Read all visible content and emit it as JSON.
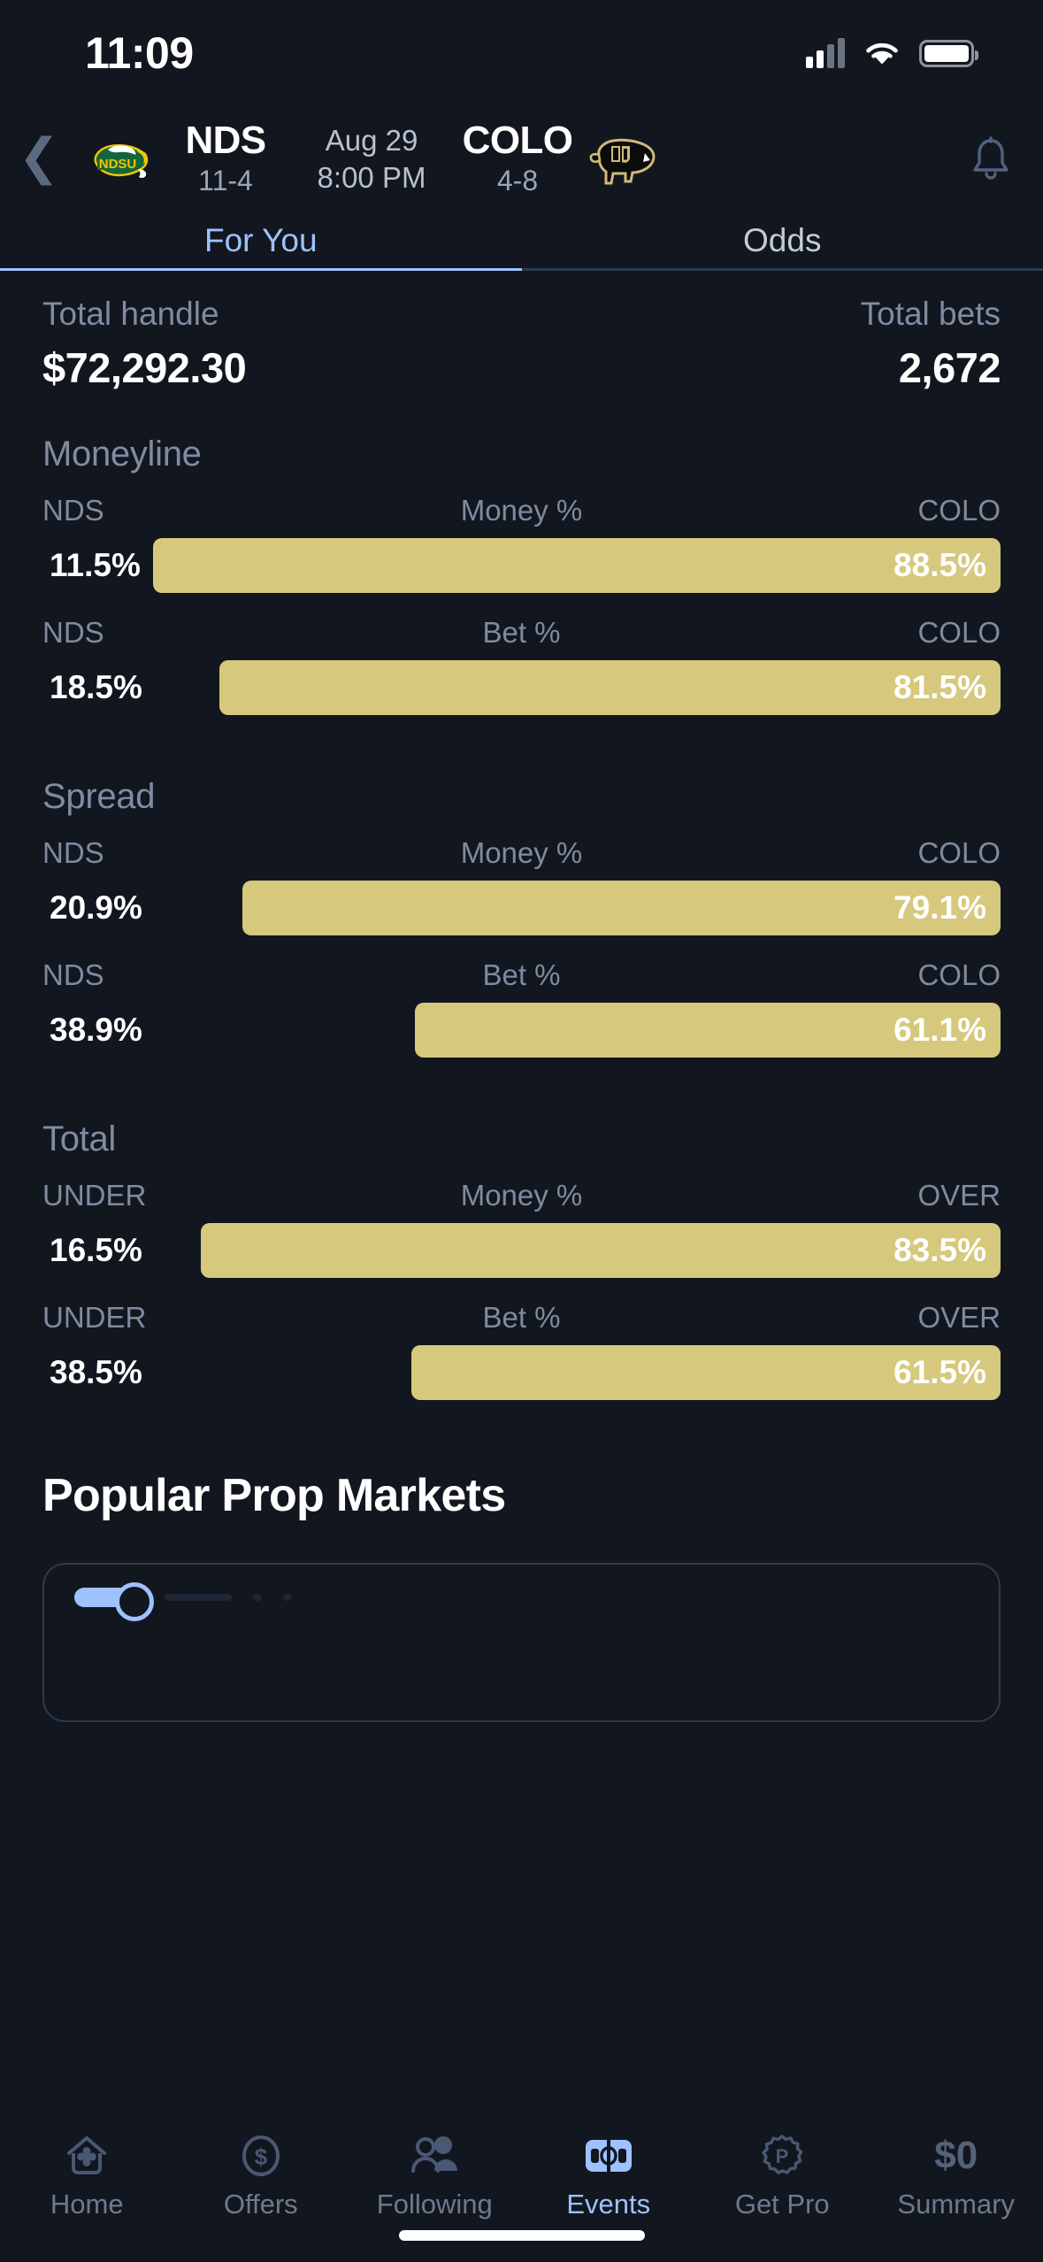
{
  "status_bar": {
    "time": "11:09",
    "signal_icon": "cellular-signal-icon",
    "wifi_icon": "wifi-icon",
    "battery_icon": "battery-icon"
  },
  "header": {
    "back_icon": "chevron-left-icon",
    "bell_icon": "bell-icon",
    "away": {
      "abbr": "NDS",
      "record": "11-4",
      "logo": "ndsu-bison-logo"
    },
    "home": {
      "abbr": "COLO",
      "record": "4-8",
      "logo": "colorado-buffaloes-logo"
    },
    "date": "Aug 29",
    "time": "8:00 PM"
  },
  "tabs": [
    {
      "label": "For You",
      "active": true
    },
    {
      "label": "Odds",
      "active": false
    }
  ],
  "summary": {
    "total_handle_label": "Total handle",
    "total_handle_value": "$72,292.30",
    "total_bets_label": "Total bets",
    "total_bets_value": "2,672"
  },
  "colors": {
    "bar_fill": "#d6c87c",
    "accent": "#9dc2ff",
    "background": "#12161f",
    "muted_text": "#7f8ca1"
  },
  "chart_data": {
    "type": "bar",
    "title": "Betting splits by market",
    "orientation": "horizontal-opposed",
    "markets": [
      {
        "name": "Moneyline",
        "left_label": "NDS",
        "right_label": "COLO",
        "rows": [
          {
            "metric": "Money %",
            "left_value": "11.5%",
            "right_value": "88.5%",
            "left_pct": 11.5,
            "right_pct": 88.5
          },
          {
            "metric": "Bet %",
            "left_value": "18.5%",
            "right_value": "81.5%",
            "left_pct": 18.5,
            "right_pct": 81.5
          }
        ]
      },
      {
        "name": "Spread",
        "left_label": "NDS",
        "right_label": "COLO",
        "rows": [
          {
            "metric": "Money %",
            "left_value": "20.9%",
            "right_value": "79.1%",
            "left_pct": 20.9,
            "right_pct": 79.1
          },
          {
            "metric": "Bet %",
            "left_value": "38.9%",
            "right_value": "61.1%",
            "left_pct": 38.9,
            "right_pct": 61.1
          }
        ]
      },
      {
        "name": "Total",
        "left_label": "UNDER",
        "right_label": "OVER",
        "rows": [
          {
            "metric": "Money %",
            "left_value": "16.5%",
            "right_value": "83.5%",
            "left_pct": 16.5,
            "right_pct": 83.5
          },
          {
            "metric": "Bet %",
            "left_value": "38.5%",
            "right_value": "61.5%",
            "left_pct": 38.5,
            "right_pct": 61.5
          }
        ]
      }
    ]
  },
  "popular_props": {
    "heading": "Popular Prop Markets"
  },
  "bottom_nav": [
    {
      "label": "Home",
      "icon": "home-clover-icon",
      "active": false
    },
    {
      "label": "Offers",
      "icon": "dollar-circle-icon",
      "active": false
    },
    {
      "label": "Following",
      "icon": "people-icon",
      "active": false
    },
    {
      "label": "Events",
      "icon": "scoreboard-icon",
      "active": true
    },
    {
      "label": "Get Pro",
      "icon": "pro-badge-icon",
      "active": false
    },
    {
      "label": "Summary",
      "icon": "dollar-zero-icon",
      "icon_text": "$0",
      "active": false
    }
  ]
}
